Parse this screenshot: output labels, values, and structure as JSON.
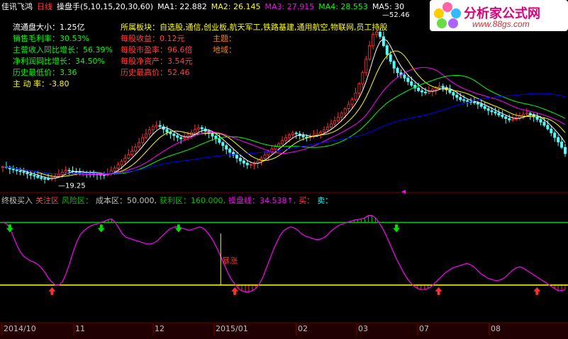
{
  "title_bar": {
    "name": "佳讯飞鸿",
    "period": "日线",
    "indicator": "操盘手(5,10,15,20,30,60)",
    "ma": [
      {
        "label": "MA1: 22.882",
        "color": "#ffffff"
      },
      {
        "label": "MA2: 26.145",
        "color": "#ffff00"
      },
      {
        "label": "MA3: 27.915",
        "color": "#ff00ff"
      },
      {
        "label": "MA4: 28.553",
        "color": "#00ff00"
      },
      {
        "label": "MA5: 30",
        "color": "#ffffff"
      }
    ]
  },
  "info_left": [
    {
      "text": "流通盘大小：1.25亿",
      "color": "#ffffff"
    },
    {
      "text": "销售毛利率：30.53%",
      "color": "#00ff00"
    },
    {
      "text": "主营收入同比增长：56.39%",
      "color": "#00ff00"
    },
    {
      "text": "净利润同比增长：34.50%",
      "color": "#00ff00"
    },
    {
      "text": "历史最低价：3.36",
      "color": "#00ff00"
    },
    {
      "text": "主 动 率：-3.80",
      "color": "#ffff00"
    }
  ],
  "info_mid": [
    {
      "text": "所属板块：自选股,通信,创业板,航天军工,铁路基建,通用航空,物联网,员工持股",
      "color": "#ffff00"
    },
    {
      "text": "每股收益：0.12元",
      "color": "#ff4040"
    },
    {
      "text": "每股市盈率：96.6倍",
      "color": "#ff4040"
    },
    {
      "text": "每股净资产：3.54元",
      "color": "#ff4040"
    },
    {
      "text": "历史最高价：52.46",
      "color": "#ff4040"
    }
  ],
  "info_right": [
    {
      "text": "主题：",
      "color": "#ff8000"
    },
    {
      "text": "地域：",
      "color": "#ff8000"
    }
  ],
  "indicator_header": [
    {
      "text": "终极买入",
      "color": "#c0c0c0"
    },
    {
      "text": "关注区",
      "color": "#ff4040"
    },
    {
      "text": "风险区：",
      "color": "#00c000"
    },
    {
      "text": "成本区：50.000,",
      "color": "#c0c0c0"
    },
    {
      "text": "获利区：160.000,",
      "color": "#00c000"
    },
    {
      "text": "操盘线：34.538↑,",
      "color": "#ff00ff"
    },
    {
      "text": "买：",
      "color": "#ff4040"
    },
    {
      "text": "卖：",
      "color": "#00ffff"
    }
  ],
  "x_axis_labels": [
    {
      "text": "2014/10",
      "color": "#c0c0c0"
    },
    {
      "text": "11",
      "color": "#c0c0c0"
    },
    {
      "text": "12",
      "color": "#c0c0c0"
    },
    {
      "text": "2015/01",
      "color": "#c0c0c0"
    },
    {
      "text": "02",
      "color": "#c0c0c0"
    },
    {
      "text": "03",
      "color": "#c0c0c0"
    },
    {
      "text": "07",
      "color": "#c0c0c0"
    },
    {
      "text": "08",
      "color": "#c0c0c0"
    }
  ],
  "watermark": {
    "line1": "分析家公式网",
    "line2": "www.88gs.com"
  },
  "chart_data": {
    "type": "line",
    "main_panel": {
      "price_min_label": "19.25",
      "price_max_label": "52.46",
      "ylim": [
        17,
        56
      ],
      "candles_close": [
        22.1,
        22.0,
        21.6,
        21.4,
        21.2,
        21.0,
        20.8,
        20.5,
        20.2,
        20.0,
        19.7,
        19.5,
        19.4,
        19.3,
        19.6,
        20.0,
        20.4,
        20.9,
        21.3,
        21.2,
        21.0,
        20.9,
        20.8,
        20.8,
        20.7,
        20.6,
        20.5,
        20.4,
        20.3,
        20.2,
        20.6,
        21.2,
        21.8,
        22.5,
        23.3,
        24.0,
        24.8,
        25.6,
        26.5,
        27.5,
        28.6,
        29.4,
        30.3,
        31.0,
        31.3,
        31.0,
        30.4,
        29.8,
        29.4,
        29.0,
        28.6,
        28.3,
        28.6,
        29.1,
        29.7,
        30.4,
        30.8,
        30.5,
        30.0,
        29.5,
        28.9,
        28.3,
        27.5,
        26.8,
        26.0,
        25.3,
        24.7,
        24.0,
        23.4,
        22.9,
        22.5,
        22.6,
        22.9,
        23.4,
        24.0,
        24.7,
        25.4,
        26.0,
        26.6,
        27.2,
        27.9,
        28.6,
        29.2,
        29.6,
        29.4,
        29.0,
        28.7,
        28.6,
        28.8,
        29.1,
        29.4,
        29.8,
        30.3,
        30.9,
        31.6,
        32.3,
        33.1,
        34.0,
        35.0,
        36.0,
        37.0,
        38.5,
        40.5,
        43.0,
        46.0,
        49.0,
        51.5,
        52.0,
        51.0,
        49.0,
        47.0,
        45.5,
        44.0,
        43.0,
        42.5,
        41.8,
        41.0,
        40.2,
        39.6,
        39.0,
        38.7,
        38.5,
        38.8,
        39.3,
        39.7,
        40.0,
        39.7,
        39.2,
        38.6,
        38.0,
        37.5,
        37.0,
        36.8,
        36.6,
        36.5,
        36.3,
        36.0,
        35.5,
        35.0,
        34.6,
        34.3,
        34.0,
        33.6,
        33.2,
        32.8,
        32.5,
        32.6,
        33.0,
        33.4,
        33.8,
        34.0,
        33.7,
        33.2,
        32.6,
        32.0,
        31.3,
        30.5,
        29.6,
        28.6,
        27.6,
        26.4,
        25.0
      ],
      "ma_lines": [
        {
          "name": "MA1",
          "color": "#ffffff"
        },
        {
          "name": "MA2",
          "color": "#ffff00"
        },
        {
          "name": "MA3",
          "color": "#ff00ff"
        },
        {
          "name": "MA4",
          "color": "#00ff00"
        },
        {
          "name": "MA6",
          "color": "#0000ff"
        }
      ]
    },
    "indicator_panel": {
      "ylim": [
        0,
        200
      ],
      "levels": [
        {
          "name": "成本区",
          "value": 50,
          "color": "#ffff00"
        },
        {
          "name": "获利区",
          "value": 160,
          "color": "#00c000"
        }
      ],
      "operating_line": [
        160,
        158,
        150,
        135,
        120,
        108,
        100,
        96,
        92,
        90,
        86,
        80,
        72,
        62,
        55,
        50,
        50,
        56,
        70,
        88,
        108,
        125,
        138,
        145,
        150,
        154,
        156,
        158,
        160,
        162,
        165,
        166,
        160,
        150,
        140,
        134,
        132,
        130,
        128,
        126,
        124,
        122,
        122,
        124,
        128,
        134,
        140,
        146,
        150,
        152,
        152,
        150,
        148,
        146,
        148,
        150,
        152,
        150,
        144,
        136,
        126,
        114,
        100,
        86,
        72,
        60,
        52,
        44,
        40,
        38,
        38,
        40,
        44,
        52,
        64,
        80,
        96,
        112,
        126,
        138,
        146,
        150,
        152,
        150,
        146,
        140,
        136,
        134,
        132,
        130,
        130,
        132,
        136,
        142,
        148,
        152,
        156,
        158,
        160,
        162,
        164,
        165,
        166,
        168,
        172,
        172,
        168,
        160,
        150,
        138,
        124,
        110,
        96,
        84,
        72,
        62,
        54,
        48,
        44,
        42,
        42,
        44,
        48,
        54,
        60,
        66,
        72,
        76,
        80,
        82,
        84,
        86,
        88,
        86,
        82,
        76,
        70,
        66,
        62,
        60,
        58,
        58,
        60,
        64,
        70,
        76,
        80,
        82,
        80,
        76,
        72,
        68,
        64,
        60,
        56,
        52,
        48,
        44,
        40,
        40,
        42
      ],
      "buy_signals": [
        14,
        66,
        124,
        152
      ],
      "sell_signals": [
        2,
        28,
        50,
        112
      ],
      "spike_label": "暴涨",
      "spike_index": 62
    }
  }
}
